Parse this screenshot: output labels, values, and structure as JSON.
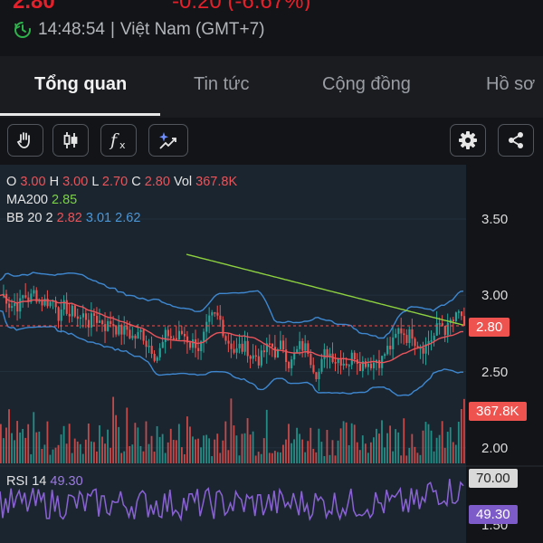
{
  "header": {
    "price_partial": "2.80",
    "change_partial": "-0.20 (-6.67%)",
    "time": "14:48:54",
    "separator": "|",
    "timezone": "Việt Nam (GMT+7)"
  },
  "tabs": [
    {
      "label": "Tổng quan",
      "active": true
    },
    {
      "label": "Tin tức",
      "active": false
    },
    {
      "label": "Cộng đồng",
      "active": false
    },
    {
      "label": "Hồ sơ",
      "active": false
    }
  ],
  "toolbar": {
    "left_icons": [
      "hand-icon",
      "candlestick-icon",
      "function-icon",
      "ai-sparkle-icon"
    ],
    "right_icons": [
      "gear-icon",
      "share-icon"
    ]
  },
  "legend": {
    "ohlc": {
      "o_label": "O",
      "o": "3.00",
      "h_label": "H",
      "h": "3.00",
      "l_label": "L",
      "l": "2.70",
      "c_label": "C",
      "c": "2.80",
      "vol_label": "Vol",
      "vol": "367.8K"
    },
    "ma": {
      "label": "MA200",
      "value": "2.85"
    },
    "bb": {
      "label": "BB 20 2",
      "mid": "2.82",
      "upper": "3.01",
      "lower": "2.62"
    },
    "rsi": {
      "label": "RSI 14",
      "value": "49.30"
    }
  },
  "price_axis": {
    "labels": [
      "3.50",
      "3.00",
      "2.50",
      "2.00",
      "1.50"
    ],
    "current_price_tag": "2.80",
    "volume_tag": "367.8K",
    "rsi_level_tag": "70.00",
    "rsi_value_tag": "49.30"
  },
  "colors": {
    "up": "#26a69a",
    "down": "#ef5350",
    "ma": "#8ed13f",
    "bb_band": "#3f88d0",
    "bb_mid": "#e9545a",
    "rsi": "#8a63d2",
    "accent_red": "#e5202b"
  },
  "chart_data": {
    "type": "candlestick",
    "y_range": [
      1.4,
      3.7
    ],
    "last_close": 2.8,
    "rsi_level": 70,
    "rsi_last": 49.3
  }
}
